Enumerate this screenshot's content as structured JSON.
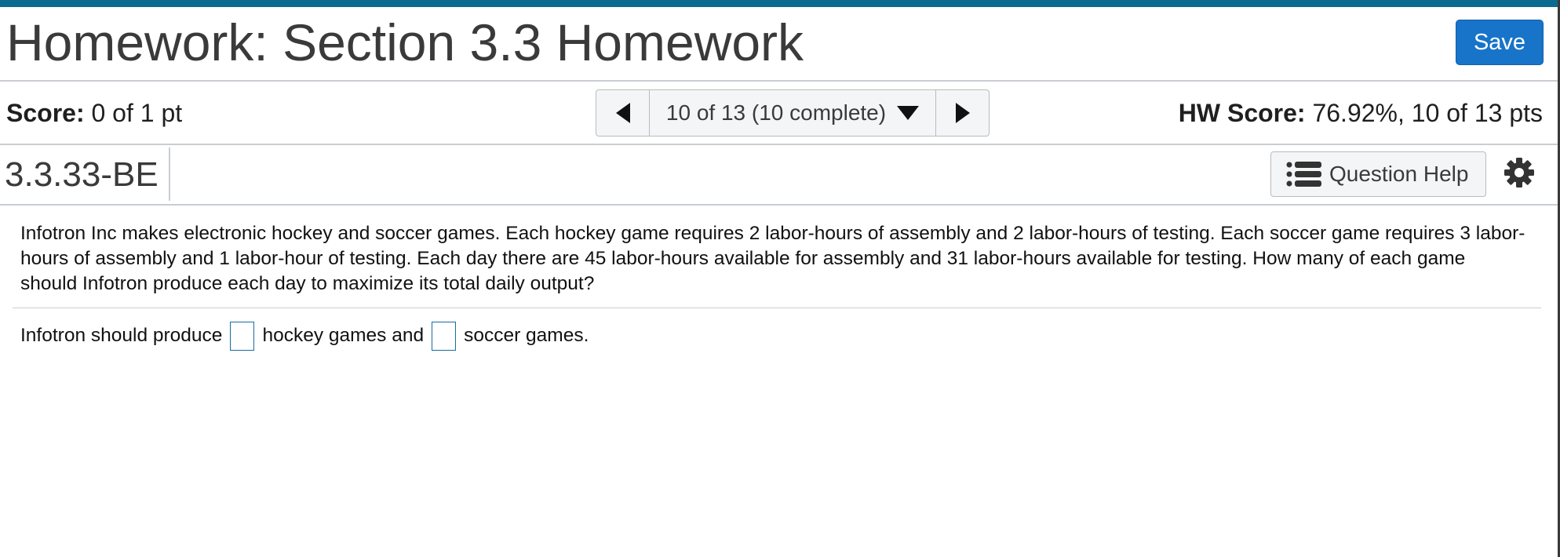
{
  "header": {
    "title": "Homework: Section 3.3 Homework",
    "save_label": "Save"
  },
  "score_bar": {
    "score_label": "Score:",
    "score_value": "0 of 1 pt",
    "question_nav": "10 of 13 (10 complete)",
    "hw_score_label": "HW Score:",
    "hw_score_value": "76.92%, 10 of 13 pts"
  },
  "question_bar": {
    "question_id": "3.3.33-BE",
    "help_label": "Question Help"
  },
  "question": {
    "text": "Infotron Inc makes electronic hockey and soccer games.  Each hockey game requires 2 labor-hours of assembly and 2 labor-hours of testing.  Each soccer game requires 3 labor-hours of assembly and 1 labor-hour of testing.  Each day there are 45 labor-hours available for assembly and 31 labor-hours available for testing.  How many of each game should Infotron produce each day to maximize its total daily output?",
    "answer_prefix": "Infotron should produce",
    "answer_middle": "hockey games and",
    "answer_suffix": "soccer games."
  },
  "icons": {
    "prev": "previous-icon",
    "next": "next-icon",
    "dropdown": "caret-down-icon",
    "help": "list-icon",
    "settings": "gear-icon"
  },
  "colors": {
    "accent": "#0b6a8f",
    "save_button": "#1874c9",
    "input_border": "#1a6c9c"
  }
}
